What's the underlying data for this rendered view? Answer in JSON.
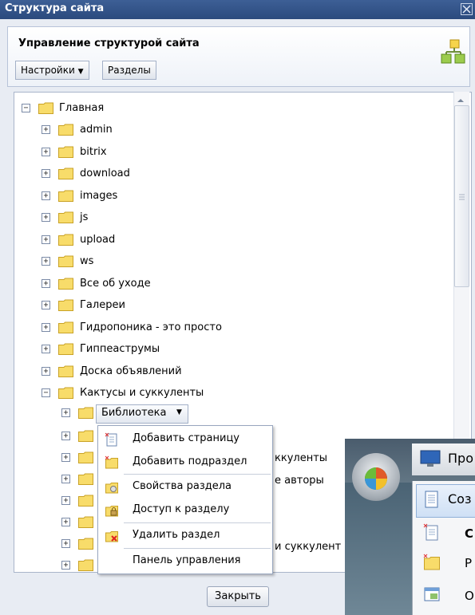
{
  "window": {
    "title": "Структура сайта"
  },
  "header": {
    "title": "Управление структурой сайта",
    "settings_label": "Настройки",
    "sections_label": "Разделы"
  },
  "tree": {
    "root_label": "Главная",
    "items": [
      {
        "label": "admin"
      },
      {
        "label": "bitrix"
      },
      {
        "label": "download"
      },
      {
        "label": "images"
      },
      {
        "label": "js"
      },
      {
        "label": "upload"
      },
      {
        "label": "ws"
      },
      {
        "label": "Все об уходе"
      },
      {
        "label": "Галереи"
      },
      {
        "label": "Гидропоника - это просто"
      },
      {
        "label": "Гиппеаструмы"
      },
      {
        "label": "Доска объявлений"
      },
      {
        "label": "Кактусы и суккуленты"
      }
    ],
    "selected_child": "Библиотека",
    "partial_children": [
      {
        "label": "ккуленты"
      },
      {
        "label": "е авторы"
      },
      {
        "label": "и суккулент"
      }
    ]
  },
  "context_menu": {
    "items": [
      {
        "label": "Добавить страницу"
      },
      {
        "label": "Добавить подраздел"
      },
      {
        "label": "Свойства раздела"
      },
      {
        "label": "Доступ к разделу"
      },
      {
        "label": "Удалить раздел"
      },
      {
        "label": "Панель управления"
      }
    ]
  },
  "footer": {
    "close_label": "Закрыть"
  },
  "taskbar": {
    "item1_label": "Про",
    "item2_label": "Соз",
    "menu_labels": [
      "С",
      "Р",
      "О"
    ]
  }
}
